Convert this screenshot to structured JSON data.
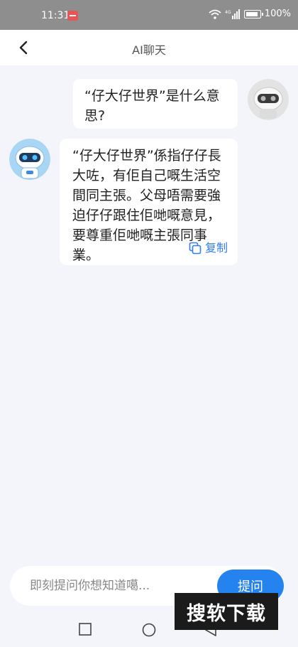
{
  "status_bar": {
    "time": "11:31",
    "battery_pct": "100%"
  },
  "header": {
    "title": "AI聊天"
  },
  "messages": {
    "user": {
      "text": "“仔大仔世界”是什么意思?"
    },
    "ai": {
      "text": "“仔大仔世界”係指仔仔長大咗，有佢自己嘅生活空間同主張。父母唔需要強迫仔仔跟住佢哋嘅意見，要尊重佢哋嘅主張同事業。",
      "copy_label": "复制"
    }
  },
  "input": {
    "placeholder": "即刻提问你想知道噶...",
    "value": "",
    "send_label": "提问"
  },
  "watermark": {
    "text": "搜软下载"
  },
  "colors": {
    "accent": "#2583f0",
    "background": "#f3f5fa",
    "status_bar": "#8e8e8e"
  },
  "icons": [
    "back-arrow-icon",
    "copy-icon",
    "wifi-icon",
    "signal-icon",
    "battery-icon",
    "nav-square-icon",
    "nav-circle-icon",
    "nav-triangle-icon"
  ]
}
